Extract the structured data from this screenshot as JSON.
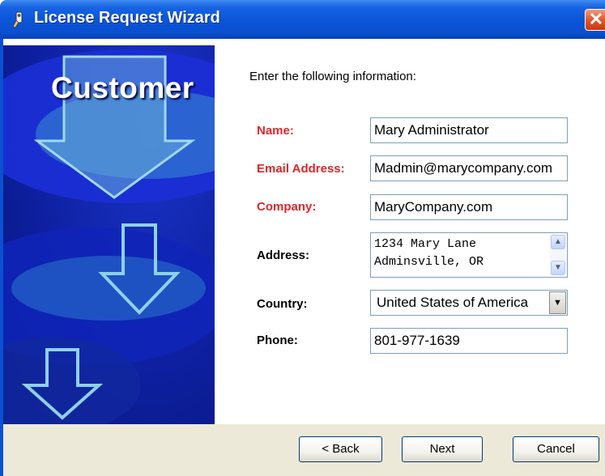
{
  "window": {
    "title": "License Request Wizard",
    "close_glyph": "✕"
  },
  "side_panel": {
    "heading": "Customer"
  },
  "form": {
    "instruction": "Enter the following information:",
    "name": {
      "label": "Name:",
      "value": "Mary Administrator"
    },
    "email": {
      "label": "Email Address:",
      "value": "Madmin@marycompany.com"
    },
    "company": {
      "label": "Company:",
      "value": "MaryCompany.com"
    },
    "address": {
      "label": "Address:",
      "value": "1234 Mary Lane\nAdminsville, OR"
    },
    "country": {
      "label": "Country:",
      "value": "United States of America"
    },
    "phone": {
      "label": "Phone:",
      "value": "801-977-1639"
    }
  },
  "buttons": {
    "back": "< Back",
    "next": "Next",
    "cancel": "Cancel"
  },
  "icons": {
    "title": "wizard-app-icon",
    "close": "close-icon",
    "scroll_up": "scroll-up-icon",
    "scroll_down": "scroll-down-icon",
    "dropdown": "chevron-down-icon"
  },
  "colors": {
    "title_bar": "#0a50d0",
    "required_label": "#e0262b",
    "panel": "#0d1f9e",
    "footer": "#ece9d8"
  }
}
